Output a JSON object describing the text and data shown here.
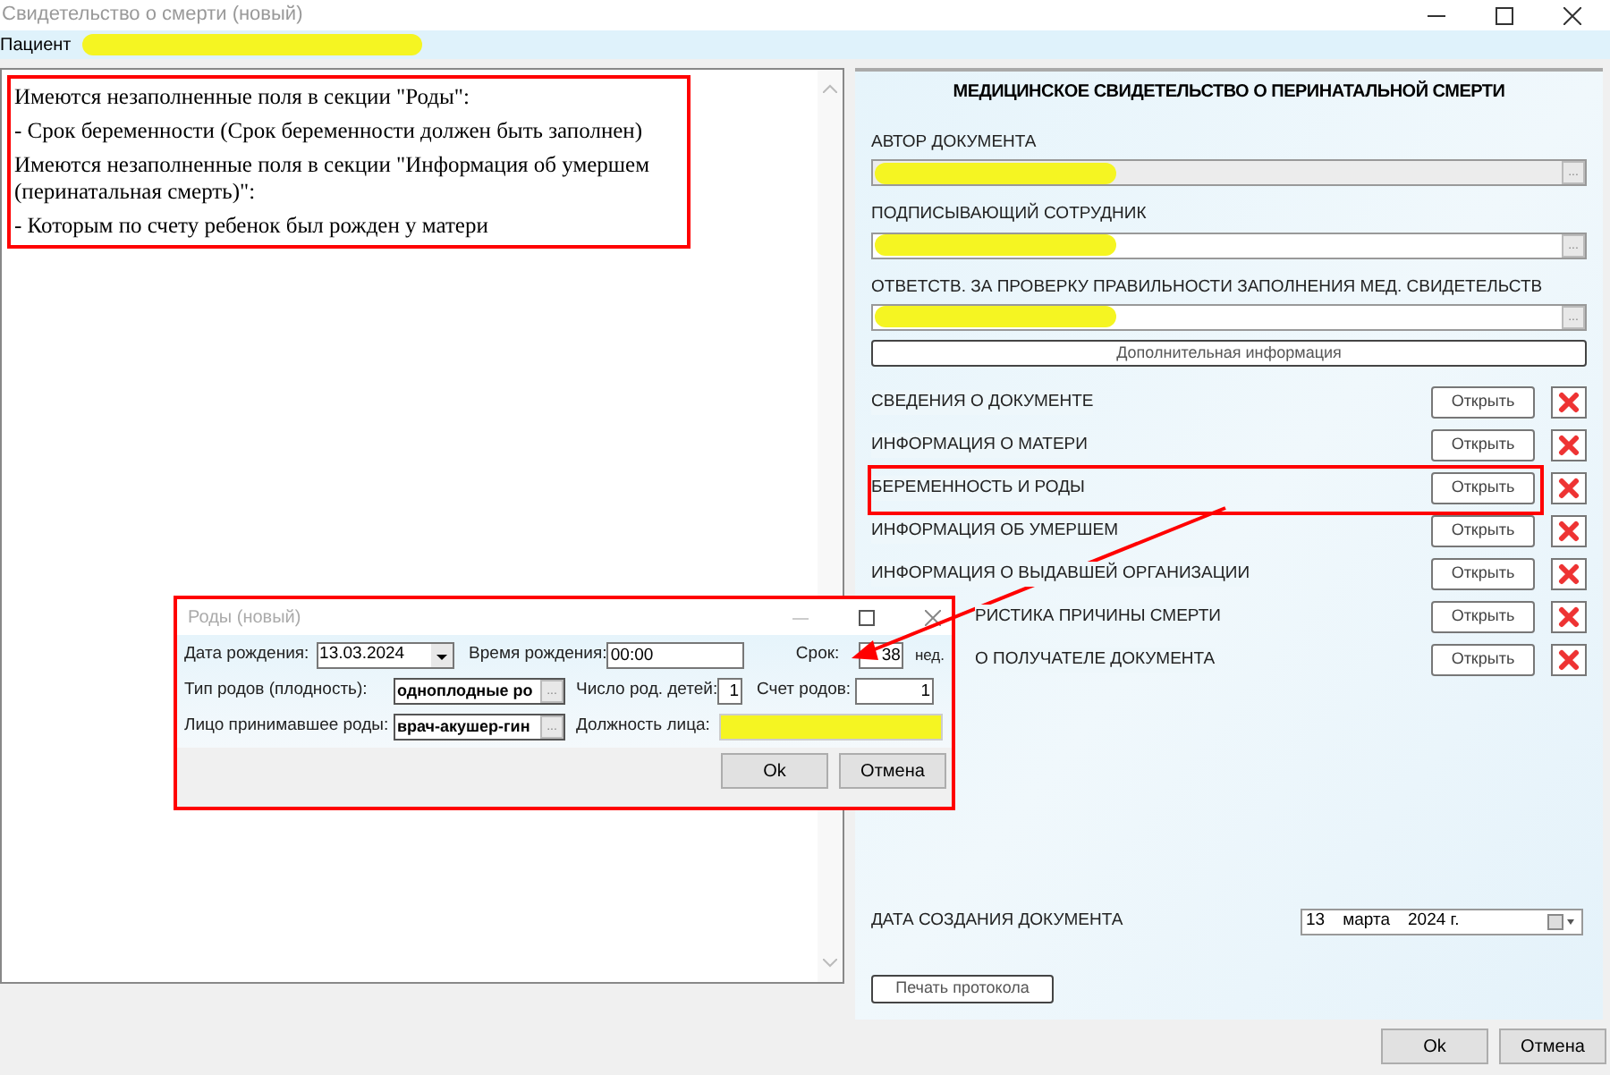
{
  "window": {
    "title": "Свидетельство о смерти (новый)"
  },
  "patient": {
    "label": "Пациент"
  },
  "messages": [
    "Имеются незаполненные поля в секции \"Роды\":",
    "- Срок беременности (Срок беременности должен быть заполнен)",
    "Имеются незаполненные поля в секции \"Информация об умершем (перинатальная смерть)\":",
    "- Которым по счету ребенок был рожден у матери"
  ],
  "form": {
    "title": "МЕДИЦИНСКОЕ СВИДЕТЕЛЬСТВО О ПЕРИНАТАЛЬНОЙ СМЕРТИ",
    "fields": [
      {
        "label": "АВТОР ДОКУМЕНТА",
        "disabled": true,
        "button": "..."
      },
      {
        "label": "ПОДПИСЫВАЮЩИЙ СОТРУДНИК",
        "disabled": false,
        "button": "..."
      },
      {
        "label": "ОТВЕТСТВ. ЗА ПРОВЕРКУ ПРАВИЛЬНОСТИ ЗАПОЛНЕНИЯ МЕД. СВИДЕТЕЛЬСТВ",
        "disabled": false,
        "button": "..."
      }
    ],
    "extra_button": "Дополнительная информация",
    "sections": [
      {
        "label": "СВЕДЕНИЯ О ДОКУМЕНТЕ",
        "open": "Открыть",
        "kind": "full",
        "highlighted": false
      },
      {
        "label": "ИНФОРМАЦИЯ О МАТЕРИ",
        "open": "Открыть",
        "kind": "full",
        "highlighted": false
      },
      {
        "label": "БЕРЕМЕННОСТЬ И РОДЫ",
        "open": "Открыть",
        "kind": "full",
        "highlighted": true
      },
      {
        "label": "ИНФОРМАЦИЯ ОБ УМЕРШЕМ",
        "open": "Открыть",
        "kind": "full",
        "highlighted": false
      },
      {
        "label": "ИНФОРМАЦИЯ О ВЫДАВШЕЙ ОРГАНИЗАЦИИ",
        "open": "Открыть",
        "kind": "full",
        "highlighted": false
      },
      {
        "label": "РИСТИКА ПРИЧИНЫ СМЕРТИ",
        "open": "Открыть",
        "kind": "partial",
        "highlighted": false
      },
      {
        "label": "О ПОЛУЧАТЕЛЕ ДОКУМЕНТА",
        "open": "Открыть",
        "kind": "partial",
        "highlighted": false
      }
    ],
    "date_label": "ДАТА СОЗДАНИЯ ДОКУМЕНТА",
    "date": {
      "day": "13",
      "month": "марта",
      "year": "2024 г."
    },
    "print_button": "Печать протокола"
  },
  "buttons": [
    "Ok",
    "Отмена"
  ],
  "dialog": {
    "title": "Роды (новый)",
    "birth_date_label": "Дата рождения:",
    "birth_date": "13.03.2024",
    "birth_time_label": "Время рождения:",
    "birth_time": "00:00",
    "term_label": "Срок:",
    "term": "38",
    "term_unit": "нед.",
    "type_label": "Тип родов (плодность):",
    "type": "одноплодные ро",
    "type_button": "...",
    "children_label": "Число род. детей:",
    "children": "1",
    "count_label": "Счет родов:",
    "count": "1",
    "person_label": "Лицо принимавшее роды:",
    "person": "врач-акушер-гин",
    "person_button": "...",
    "position_label": "Должность лица:",
    "buttons": [
      "Ok",
      "Отмена"
    ]
  }
}
